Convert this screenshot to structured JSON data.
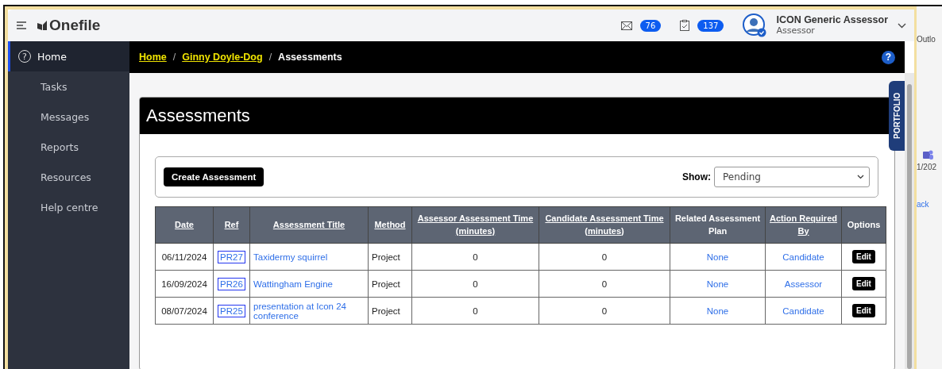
{
  "header": {
    "logo": "Onefile",
    "messages_count": "76",
    "tasks_count": "137",
    "user": {
      "name": "ICON Generic Assessor",
      "role": "Assessor"
    }
  },
  "sidebar": {
    "items": [
      {
        "label": "Home",
        "icon": "?",
        "selected": true
      },
      {
        "label": "Tasks",
        "selected": false
      },
      {
        "label": "Messages",
        "selected": false
      },
      {
        "label": "Reports",
        "selected": false
      },
      {
        "label": "Resources",
        "selected": false
      },
      {
        "label": "Help centre",
        "selected": false
      }
    ]
  },
  "breadcrumb": {
    "items": [
      {
        "label": "Home",
        "kind": "link"
      },
      {
        "label": "Ginny Doyle-Dog",
        "kind": "link"
      },
      {
        "label": "Assessments",
        "kind": "current"
      }
    ],
    "separator": "/",
    "help": "?"
  },
  "side_tab": "PORTFOLIO",
  "card": {
    "title": "Assessments",
    "create_button": "Create Assessment",
    "show_label": "Show:",
    "show_value": "Pending"
  },
  "table": {
    "columns": [
      {
        "label": "Date",
        "kind": "sort"
      },
      {
        "label": "Ref",
        "kind": "sort"
      },
      {
        "label": "Assessment Title",
        "kind": "sort"
      },
      {
        "label": "Method",
        "kind": "sort"
      },
      {
        "label": "Assessor Assessment Time (minutes)",
        "kind": "sort"
      },
      {
        "label": "Candidate Assessment Time (minutes)",
        "kind": "sort"
      },
      {
        "label": "Related Assessment Plan",
        "kind": "plain"
      },
      {
        "label": "Action Required By",
        "kind": "sort"
      },
      {
        "label": "Options",
        "kind": "plain"
      }
    ],
    "rows": [
      {
        "date": "06/11/2024",
        "ref": "PR27",
        "title": "Taxidermy squirrel",
        "method": "Project",
        "assessor_time": "0",
        "candidate_time": "0",
        "plan": "None",
        "action_by": "Candidate",
        "option": "Edit"
      },
      {
        "date": "16/09/2024",
        "ref": "PR26",
        "title": "Wattingham Engine",
        "method": "Project",
        "assessor_time": "0",
        "candidate_time": "0",
        "plan": "None",
        "action_by": "Assessor",
        "option": "Edit"
      },
      {
        "date": "08/07/2024",
        "ref": "PR25",
        "title": "presentation at Icon 24 conference",
        "method": "Project",
        "assessor_time": "0",
        "candidate_time": "0",
        "plan": "None",
        "action_by": "Candidate",
        "option": "Edit"
      }
    ]
  },
  "background_window": {
    "texts": [
      "Outlo",
      "1/202",
      "ack"
    ]
  }
}
